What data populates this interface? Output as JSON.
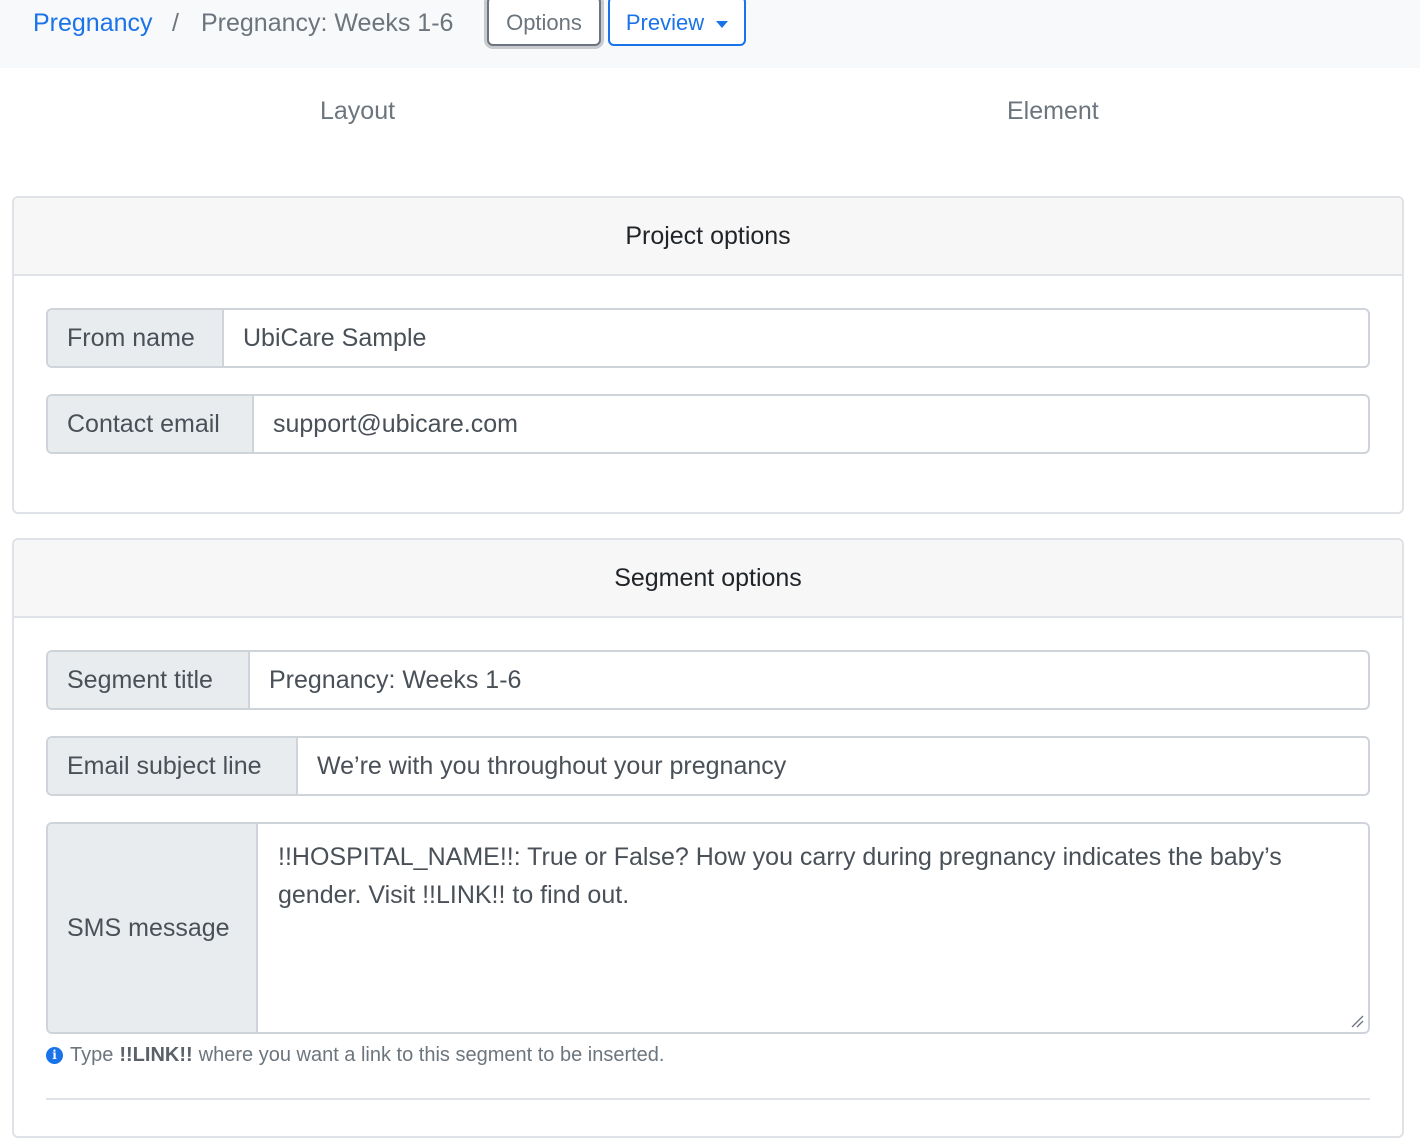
{
  "breadcrumb": {
    "parent": "Pregnancy",
    "separator": "/",
    "current": "Pregnancy: Weeks 1-6"
  },
  "toolbar": {
    "options_label": "Options",
    "preview_label": "Preview"
  },
  "tabs": {
    "layout": "Layout",
    "element": "Element"
  },
  "project_options": {
    "title": "Project options",
    "from_name_label": "From name",
    "from_name_value": "UbiCare Sample",
    "contact_email_label": "Contact email",
    "contact_email_value": "support@ubicare.com"
  },
  "segment_options": {
    "title": "Segment options",
    "segment_title_label": "Segment title",
    "segment_title_value": "Pregnancy: Weeks 1-6",
    "subject_label": "Email subject line",
    "subject_value": "We’re with you throughout your pregnancy",
    "sms_label": "SMS message",
    "sms_value": "!!HOSPITAL_NAME!!: True or False? How you carry during pregnancy indicates the baby’s gender. Visit !!LINK!! to find out.",
    "help_prefix": "Type",
    "help_keyword": "!!LINK!!",
    "help_suffix": "where you want a link to this segment to be inserted."
  },
  "colors": {
    "link_blue": "#1a73e8",
    "muted_gray": "#6c757d",
    "addon_bg": "#e9ecef",
    "border": "#ced4da"
  },
  "icons": {
    "caret": "caret-down-icon",
    "info": "info-circle-icon",
    "resize": "resize-grip-icon"
  }
}
